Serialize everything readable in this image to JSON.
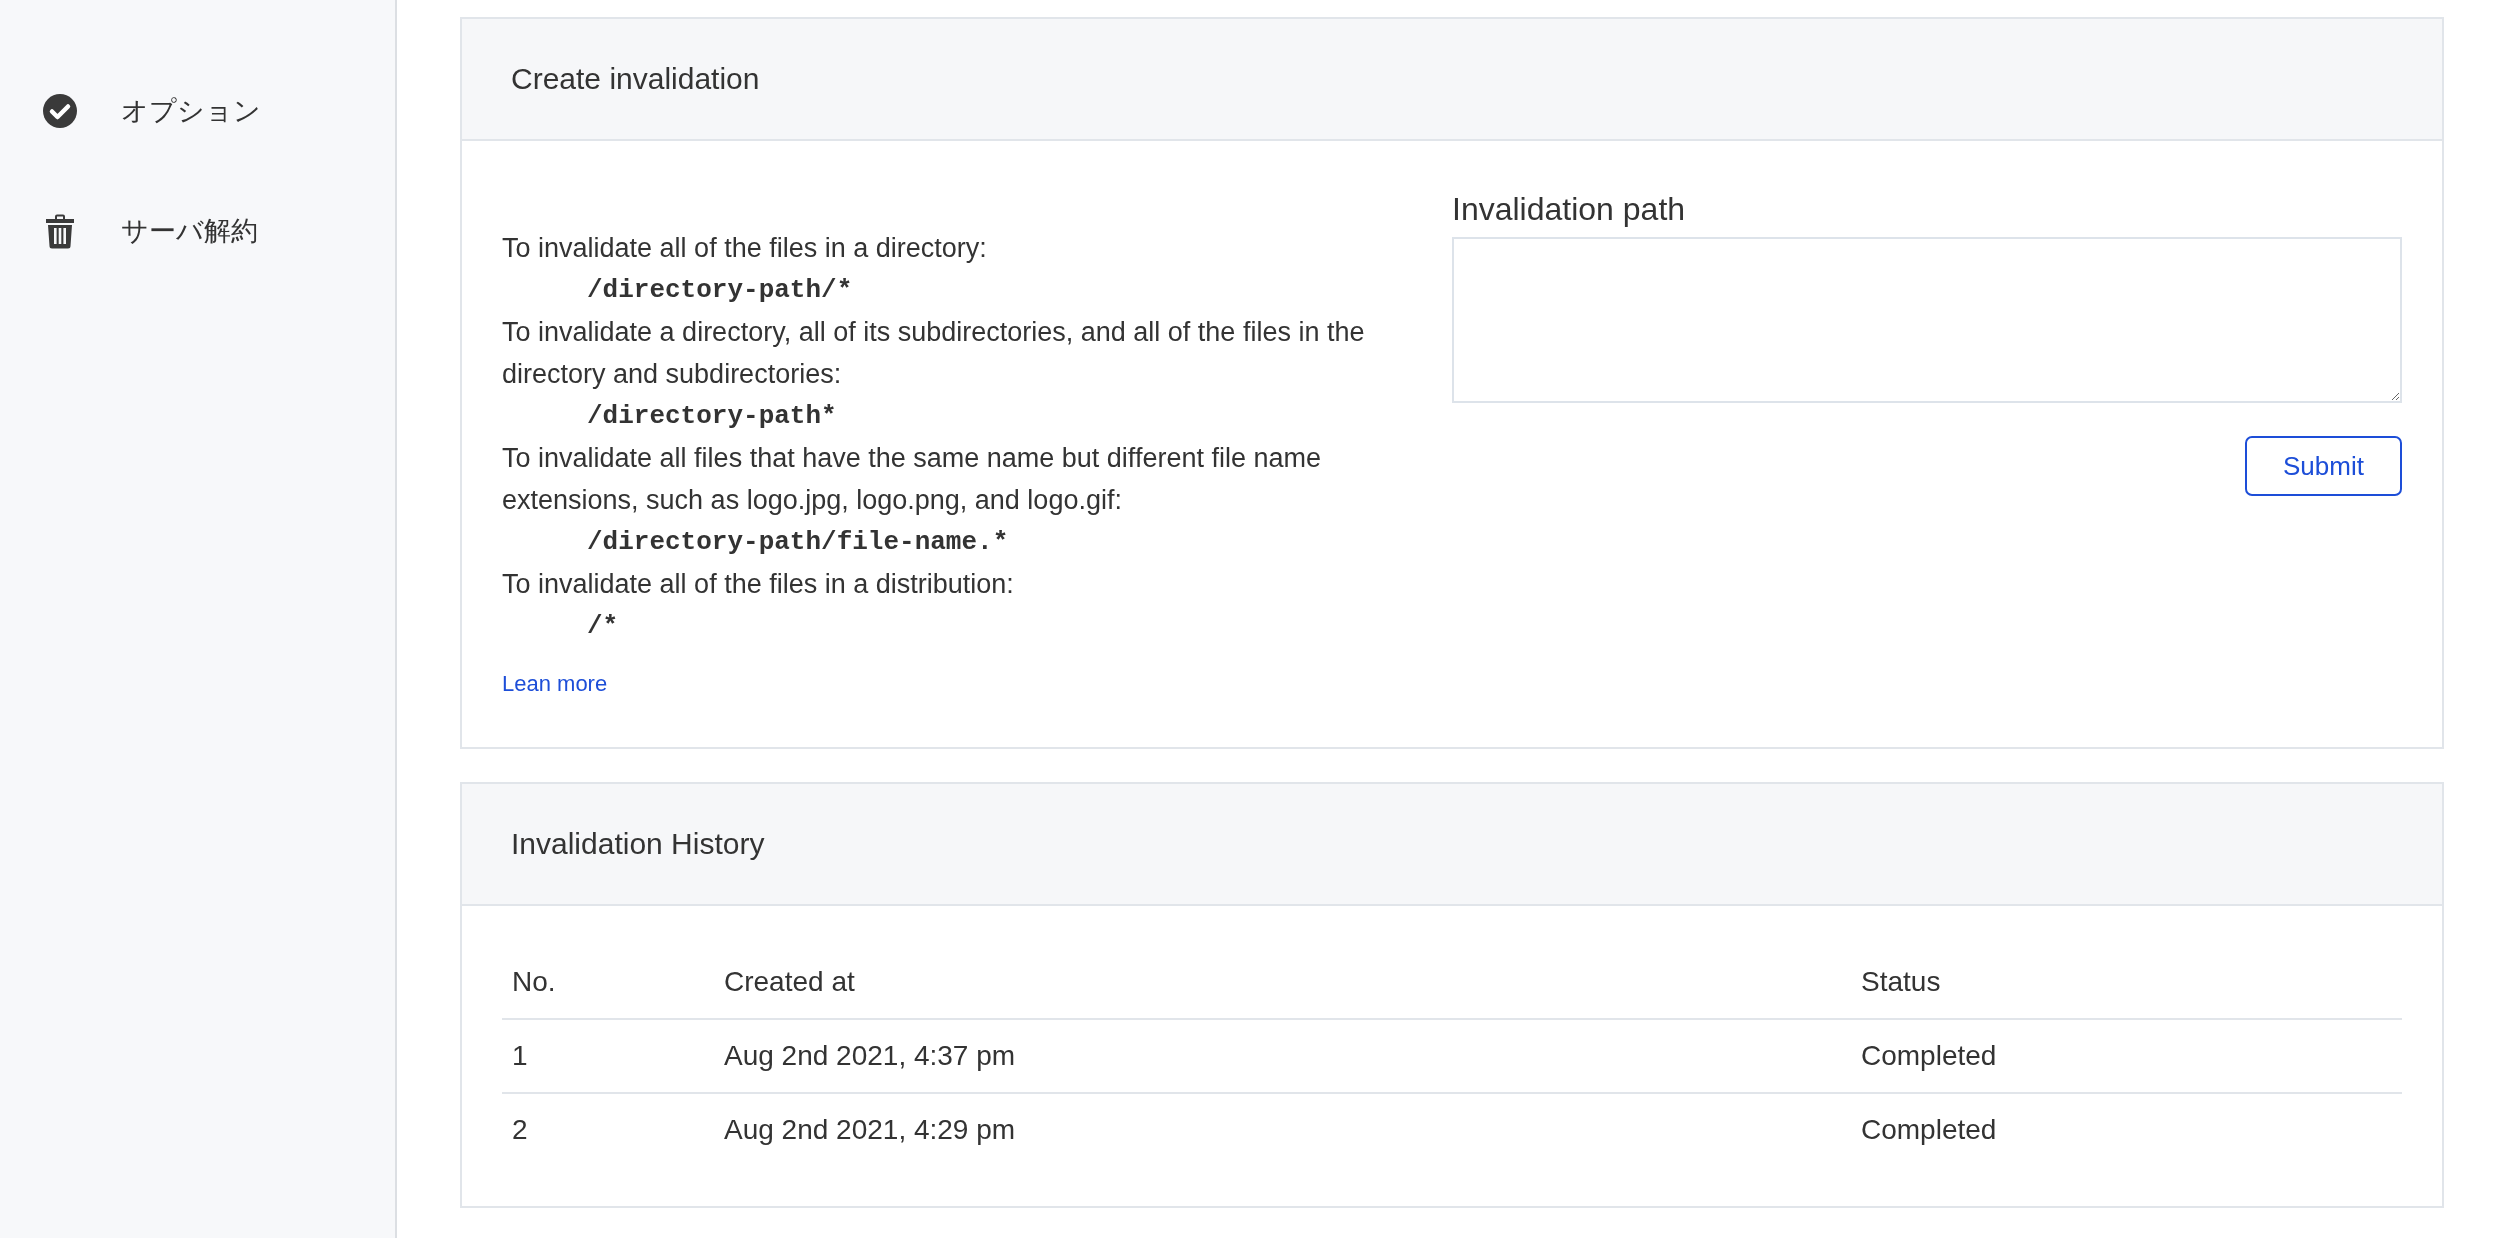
{
  "sidebar": {
    "items": [
      {
        "kind": "option",
        "label": "オプション"
      },
      {
        "kind": "cancel",
        "label": "サーバ解約"
      }
    ]
  },
  "create_invalidation": {
    "title": "Create invalidation",
    "instructions": [
      {
        "kind": "text",
        "text": "To invalidate all of the files in a directory:"
      },
      {
        "kind": "code",
        "text": "/directory-path/*"
      },
      {
        "kind": "text",
        "text": "To invalidate a directory, all of its subdirectories, and all of the files in the directory and subdirectories:"
      },
      {
        "kind": "code",
        "text": "/directory-path*"
      },
      {
        "kind": "text",
        "text": "To invalidate all files that have the same name but different file name extensions, such as logo.jpg, logo.png, and logo.gif:"
      },
      {
        "kind": "code",
        "text": "/directory-path/file-name.*"
      },
      {
        "kind": "text",
        "text": "To invalidate all of the files in a distribution:"
      },
      {
        "kind": "code",
        "text": "/*"
      }
    ],
    "learn_more_link": "Lean more",
    "path_field": {
      "label": "Invalidation path"
    },
    "submit_button": "Submit"
  },
  "invalidation_history": {
    "title": "Invalidation History",
    "columns": [
      "No.",
      "Created at",
      "Status"
    ],
    "rows": [
      [
        "1",
        "Aug 2nd 2021, 4:37 pm",
        "Completed"
      ],
      [
        "2",
        "Aug 2nd 2021, 4:29 pm",
        "Completed"
      ]
    ]
  }
}
